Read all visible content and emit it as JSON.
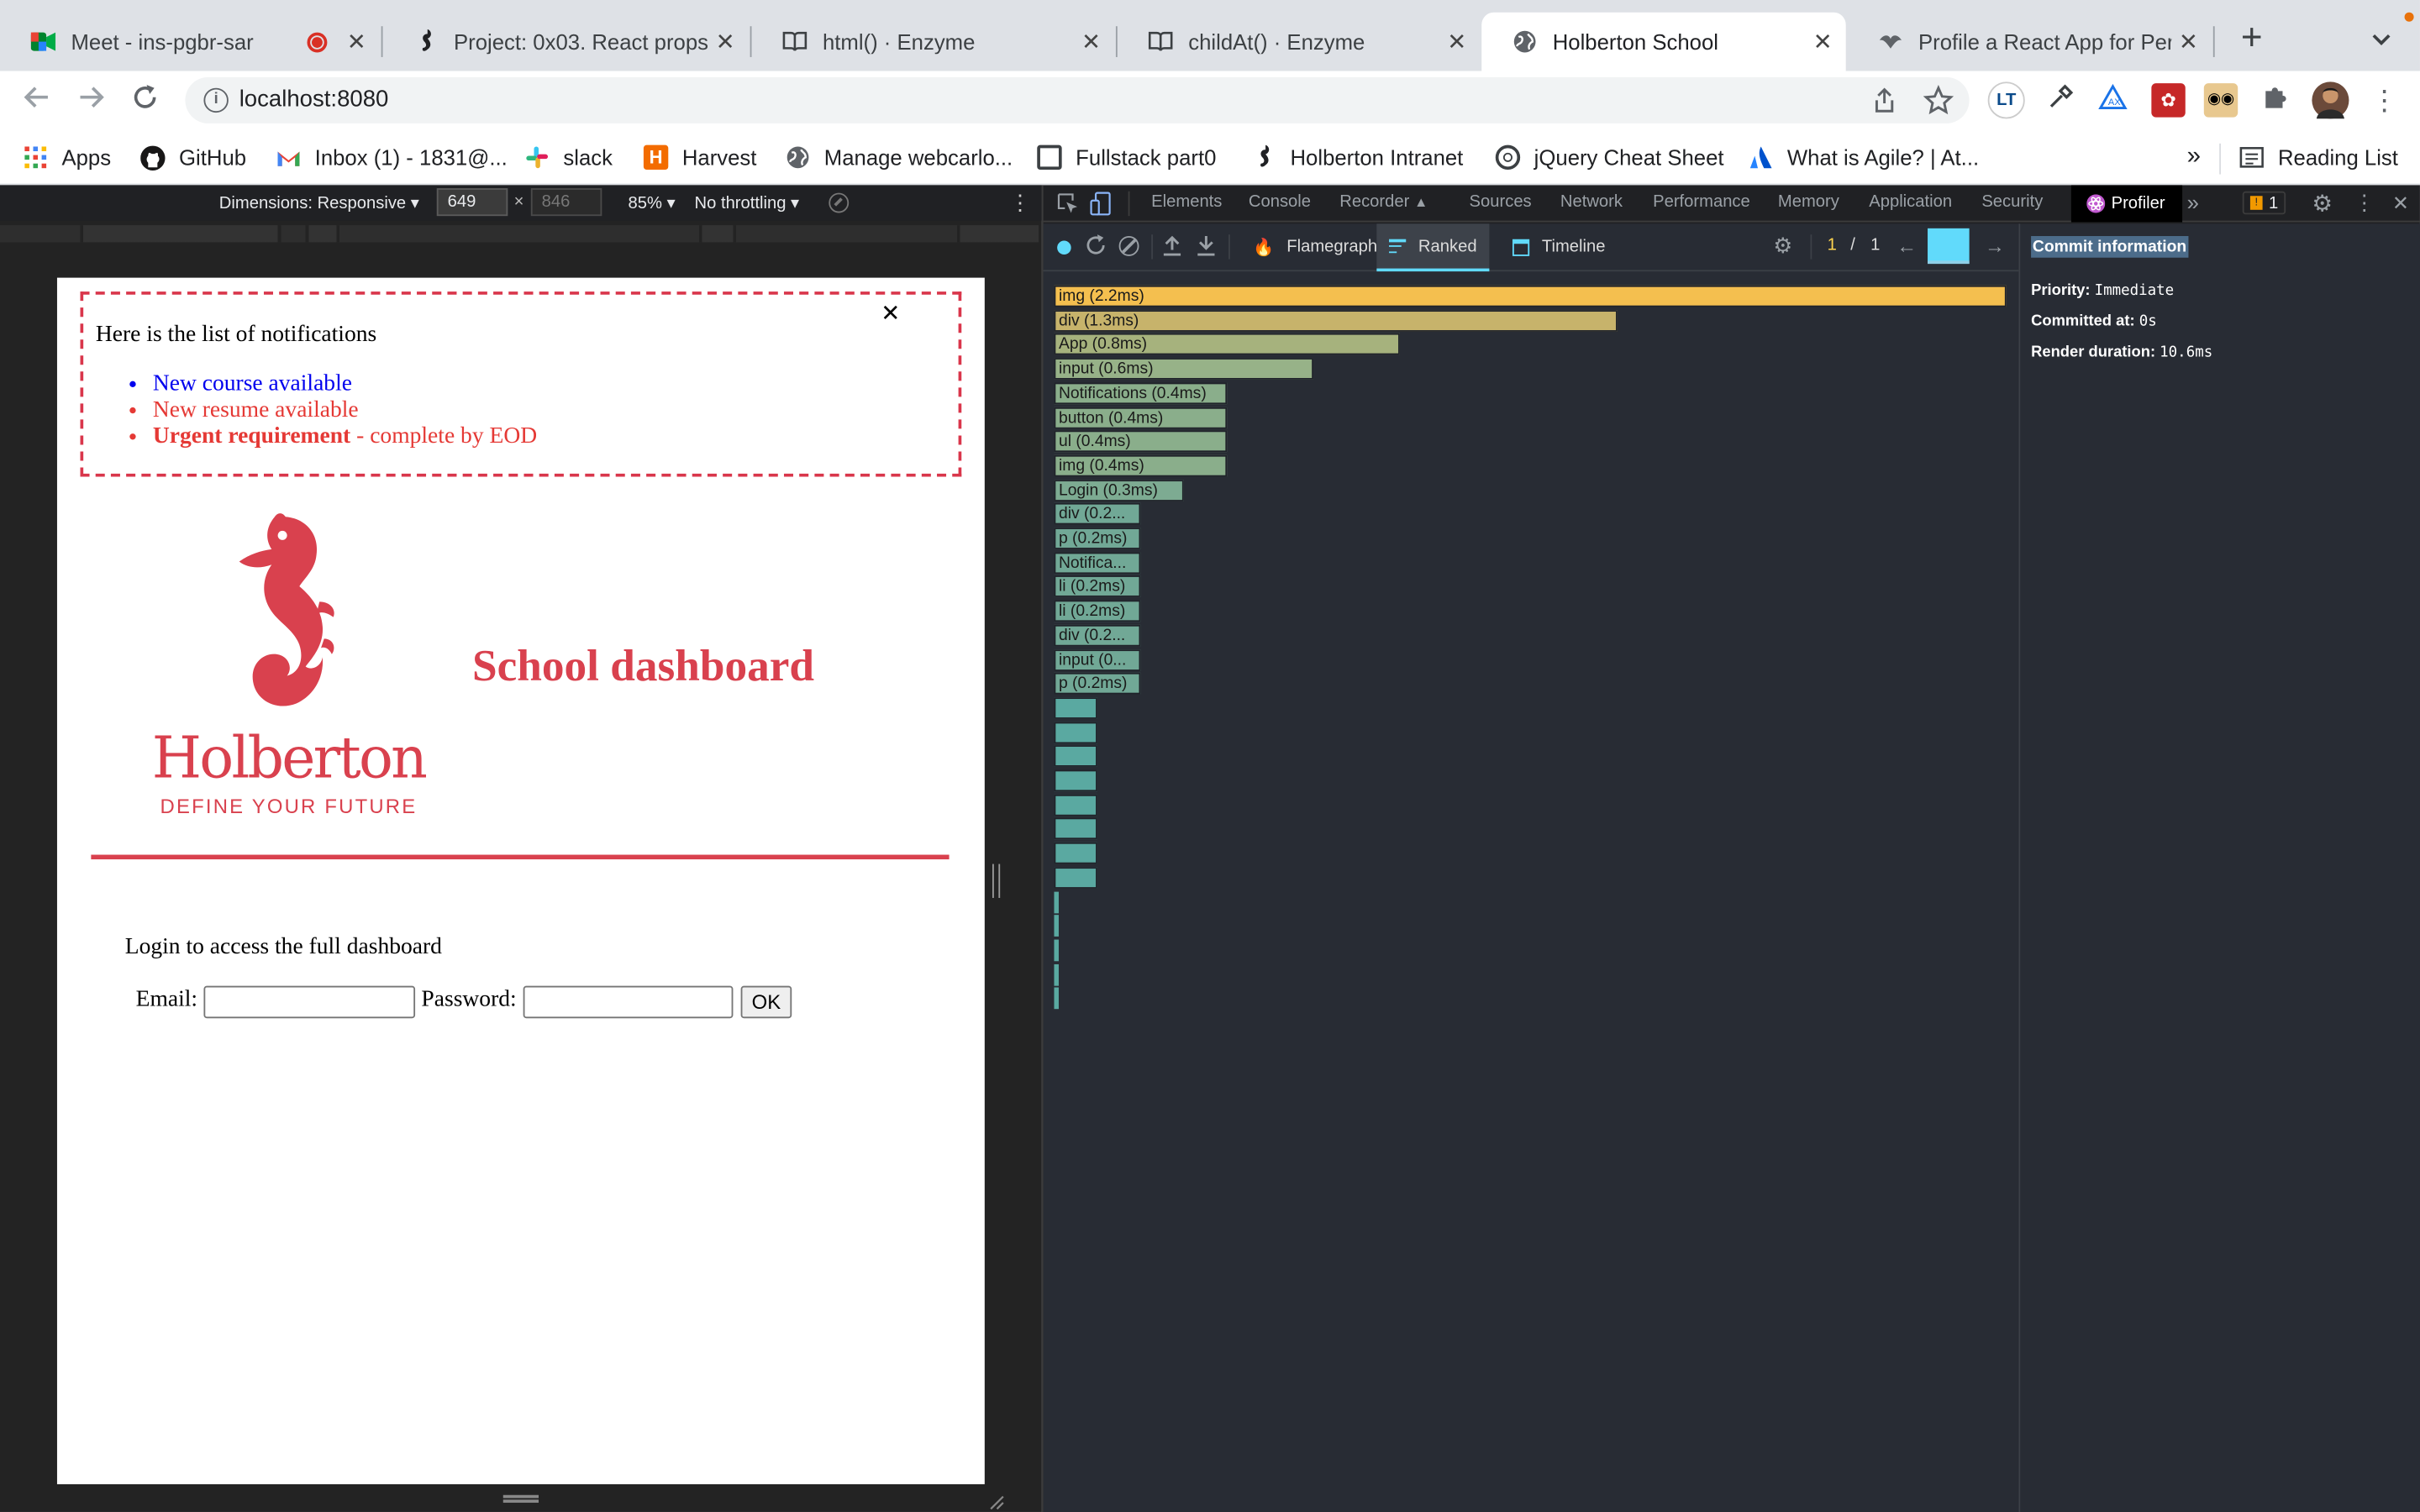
{
  "browser": {
    "tabs": [
      {
        "title": "Meet - ins-pgbr-sar",
        "icon": "google-meet-icon",
        "recording": true
      },
      {
        "title": "Project: 0x03. React props",
        "icon": "seahorse-icon"
      },
      {
        "title": "html() · Enzyme",
        "icon": "book-icon"
      },
      {
        "title": "childAt() · Enzyme",
        "icon": "book-icon"
      },
      {
        "title": "Holberton School",
        "icon": "globe-icon",
        "active": true
      },
      {
        "title": "Profile a React App for Perf",
        "icon": "bird-icon"
      }
    ],
    "url": "localhost:8080",
    "bookmarks": [
      {
        "label": "Apps",
        "icon": "apps-grid-icon"
      },
      {
        "label": "GitHub",
        "icon": "github-icon"
      },
      {
        "label": "Inbox (1) - 1831@...",
        "icon": "gmail-icon"
      },
      {
        "label": "slack",
        "icon": "slack-icon"
      },
      {
        "label": "Harvest",
        "icon": "harvest-icon"
      },
      {
        "label": "Manage webcarlo...",
        "icon": "globe-icon"
      },
      {
        "label": "Fullstack part0",
        "icon": "square-icon"
      },
      {
        "label": "Holberton Intranet",
        "icon": "seahorse-icon"
      },
      {
        "label": "jQuery Cheat Sheet",
        "icon": "circle-icon"
      },
      {
        "label": "What is Agile? | At...",
        "icon": "atlassian-icon"
      }
    ],
    "more_bookmarks": "»",
    "reading_list": "Reading List"
  },
  "emulation": {
    "dimensions_label": "Dimensions: Responsive ▾",
    "width_value": "649",
    "times": "×",
    "height_placeholder": "846",
    "zoom": "85% ▾",
    "throttling": "No throttling ▾"
  },
  "app": {
    "close_symbol": "✕",
    "notifications_title": "Here is the list of notifications",
    "notifications": [
      {
        "text": "New course available",
        "color": "#0000ee"
      },
      {
        "text": "New resume available",
        "color": "#e53935"
      },
      {
        "strong": "Urgent requirement",
        "text": " - complete by EOD",
        "color": "#e53935"
      }
    ],
    "logo_word": "Holberton",
    "logo_tagline": "DEFINE YOUR FUTURE",
    "heading": "School dashboard",
    "login_prompt": "Login to access the full dashboard",
    "email_label": "Email:",
    "password_label": "Password:",
    "ok_label": "OK",
    "brand_color": "#d9414e"
  },
  "devtools": {
    "tabs": [
      "Elements",
      "Console",
      "Recorder",
      "Sources",
      "Network",
      "Performance",
      "Memory",
      "Application",
      "Security",
      "Profiler"
    ],
    "active_tab": "Profiler",
    "more": "»",
    "issues_count": "1",
    "profiler": {
      "modes": [
        "Flamegraph",
        "Ranked",
        "Timeline"
      ],
      "active_mode": "Ranked",
      "commit_index": "1",
      "commit_sep": "/",
      "commit_total": "1",
      "ranked": [
        {
          "label": "img (2.2ms)",
          "ms": 2.2,
          "color": "#f4bf4f"
        },
        {
          "label": "div (1.3ms)",
          "ms": 1.3,
          "color": "#c7b36b"
        },
        {
          "label": "App (0.8ms)",
          "ms": 0.8,
          "color": "#a6b27d"
        },
        {
          "label": "input (0.6ms)",
          "ms": 0.6,
          "color": "#97b288"
        },
        {
          "label": "Notifications (0.4ms)",
          "ms": 0.4,
          "color": "#8aae8b"
        },
        {
          "label": "button (0.4ms)",
          "ms": 0.4,
          "color": "#8aae8b"
        },
        {
          "label": "ul (0.4ms)",
          "ms": 0.4,
          "color": "#8aae8b"
        },
        {
          "label": "img (0.4ms)",
          "ms": 0.4,
          "color": "#8aae8b"
        },
        {
          "label": "Login (0.3ms)",
          "ms": 0.3,
          "color": "#7dab92"
        },
        {
          "label": "div (0.2...",
          "ms": 0.2,
          "color": "#71a896"
        },
        {
          "label": "p (0.2ms)",
          "ms": 0.2,
          "color": "#71a896"
        },
        {
          "label": "Notifica...",
          "ms": 0.2,
          "color": "#71a896"
        },
        {
          "label": "li (0.2ms)",
          "ms": 0.2,
          "color": "#71a896"
        },
        {
          "label": "li (0.2ms)",
          "ms": 0.2,
          "color": "#71a896"
        },
        {
          "label": "div (0.2...",
          "ms": 0.2,
          "color": "#71a896"
        },
        {
          "label": "input (0...",
          "ms": 0.2,
          "color": "#71a896"
        },
        {
          "label": "p (0.2ms)",
          "ms": 0.2,
          "color": "#71a896"
        }
      ],
      "unlabeled_bars": 8,
      "thin_bars": 5,
      "commit_info": {
        "title": "Commit information",
        "priority_label": "Priority:",
        "priority_value": "Immediate",
        "committed_label": "Committed at:",
        "committed_value": "0s",
        "render_label": "Render duration:",
        "render_value": "10.6ms"
      }
    }
  }
}
